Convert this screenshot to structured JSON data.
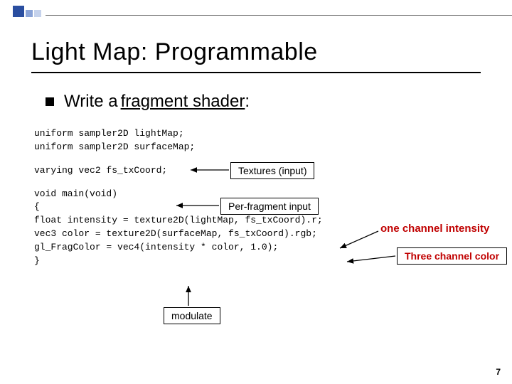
{
  "header": {
    "title": "Light Map:  Programmable"
  },
  "bullet": {
    "prefix": "Write a ",
    "underlined": "fragment shader",
    "suffix": ":"
  },
  "code": {
    "l1": "uniform sampler2D lightMap;",
    "l2": "uniform sampler2D surfaceMap;",
    "l3": "varying vec2 fs_txCoord;",
    "l4": "void main(void)",
    "l5": "{",
    "l6": "    float intensity = texture2D(lightMap, fs_txCoord).r;",
    "l7": "    vec3 color = texture2D(surfaceMap, fs_txCoord).rgb;",
    "l8": "    gl_FragColor = vec4(intensity * color, 1.0);",
    "l9": "}"
  },
  "labels": {
    "textures": "Textures (input)",
    "perfrag": "Per-fragment input",
    "onechan": "one channel intensity",
    "threechan": "Three channel color",
    "modulate": "modulate"
  },
  "page": {
    "num": "7"
  }
}
